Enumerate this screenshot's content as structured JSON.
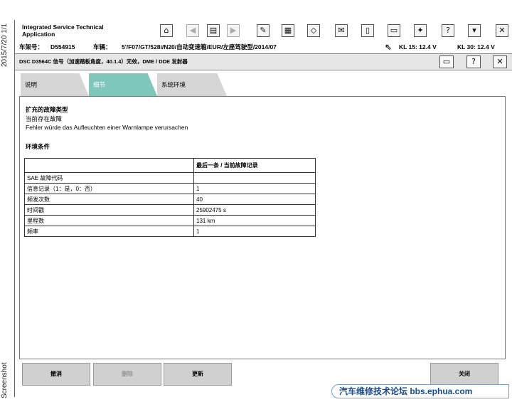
{
  "side": {
    "date": "2015/7/20  1/1",
    "label": "Screenshot"
  },
  "app": {
    "title": "Integrated Service Technical Application"
  },
  "toolbar": {
    "icons": [
      {
        "name": "home-icon",
        "glyph": "⌂"
      },
      {
        "name": "back-icon",
        "glyph": "◀"
      },
      {
        "name": "overview-icon",
        "glyph": "▤"
      },
      {
        "name": "forward-icon",
        "glyph": "▶"
      },
      {
        "name": "wrench-icon",
        "glyph": "✎"
      },
      {
        "name": "diagnosis-icon",
        "glyph": "▦"
      },
      {
        "name": "eraser-icon",
        "glyph": "◇"
      },
      {
        "name": "mail-icon",
        "glyph": "✉"
      },
      {
        "name": "battery-icon",
        "glyph": "▯"
      },
      {
        "name": "print-icon",
        "glyph": "▭"
      },
      {
        "name": "adjust-icon",
        "glyph": "✦"
      },
      {
        "name": "help-icon",
        "glyph": "?"
      },
      {
        "name": "minimize-icon",
        "glyph": "▾"
      },
      {
        "name": "close-icon",
        "glyph": "✕"
      }
    ]
  },
  "vehicle": {
    "vin_label": "车架号：",
    "vin": "D554915",
    "vehicle_label": "车辆：",
    "vehicle": "5'/F07/GT/528i/N20/自动变速箱/EUR/左座驾驶型/2014/07",
    "kl15": "KL 15:  12.4 V",
    "kl30": "KL 30:  12.4 V"
  },
  "module": {
    "title": "DSC D3564C 信号（加速踏板角度，40.1.4）无效，DME / DDE 发射器",
    "print_glyph": "▭",
    "help_glyph": "?",
    "close_glyph": "✕"
  },
  "tabs": [
    {
      "label": "说明",
      "active": false
    },
    {
      "label": "细节",
      "active": true
    },
    {
      "label": "系统环境",
      "active": false
    }
  ],
  "details": {
    "fault_type_heading": "扩充的故障类型",
    "fault_line1": "当前存在故障",
    "fault_line2": "Fehler würde das Aufleuchten einer Warnlampe verursachen",
    "env_heading": "环境条件",
    "table": {
      "header": [
        "",
        "最后一条 / 当前故障记录"
      ],
      "rows": [
        [
          "SAE 故障代码",
          ""
        ],
        [
          "信息记录（1：是，0：否）",
          "1"
        ],
        [
          "频发次数",
          "40"
        ],
        [
          "时间戳",
          "25902475 s"
        ],
        [
          "里程数",
          "131 km"
        ],
        [
          "频率",
          "1"
        ]
      ]
    }
  },
  "footer": {
    "cancel": "撤消",
    "disabled_label": "删除",
    "update": "更新",
    "close": "关闭"
  },
  "watermark": "汽车维修技术论坛 bbs.ephua.com"
}
